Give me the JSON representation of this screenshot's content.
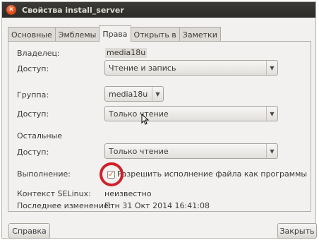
{
  "window": {
    "title": "Свойства install_server",
    "close_icon": "close-icon"
  },
  "tabs": [
    {
      "label": "Основные",
      "active": false
    },
    {
      "label": "Эмблемы",
      "active": false
    },
    {
      "label": "Права",
      "active": true
    },
    {
      "label": "Открыть в",
      "active": false
    },
    {
      "label": "Заметки",
      "active": false
    }
  ],
  "permissions": {
    "owner_label": "Владелец:",
    "owner_value": "media18u",
    "owner_access_label": "Доступ:",
    "owner_access_value": "Чтение и запись",
    "group_label": "Группа:",
    "group_value": "media18u",
    "group_access_label": "Доступ:",
    "group_access_value": "Только чтение",
    "others_label": "Остальные",
    "others_access_label": "Доступ:",
    "others_access_value": "Только чтение",
    "execute_label": "Выполнение:",
    "execute_checkbox_label": "Разрешить исполнение файла как программы",
    "execute_checked": true,
    "selinux_label": "Контекст SELinux:",
    "selinux_value": "неизвестно",
    "modified_label": "Последнее изменение:",
    "modified_value": "Птн 31 Окт 2014 16:41:08"
  },
  "buttons": {
    "help": "Справка",
    "close": "Закрыть"
  },
  "colors": {
    "titlebar": "#3c3b37",
    "accent": "#d85a1a",
    "highlight_ring": "#d0202a"
  }
}
